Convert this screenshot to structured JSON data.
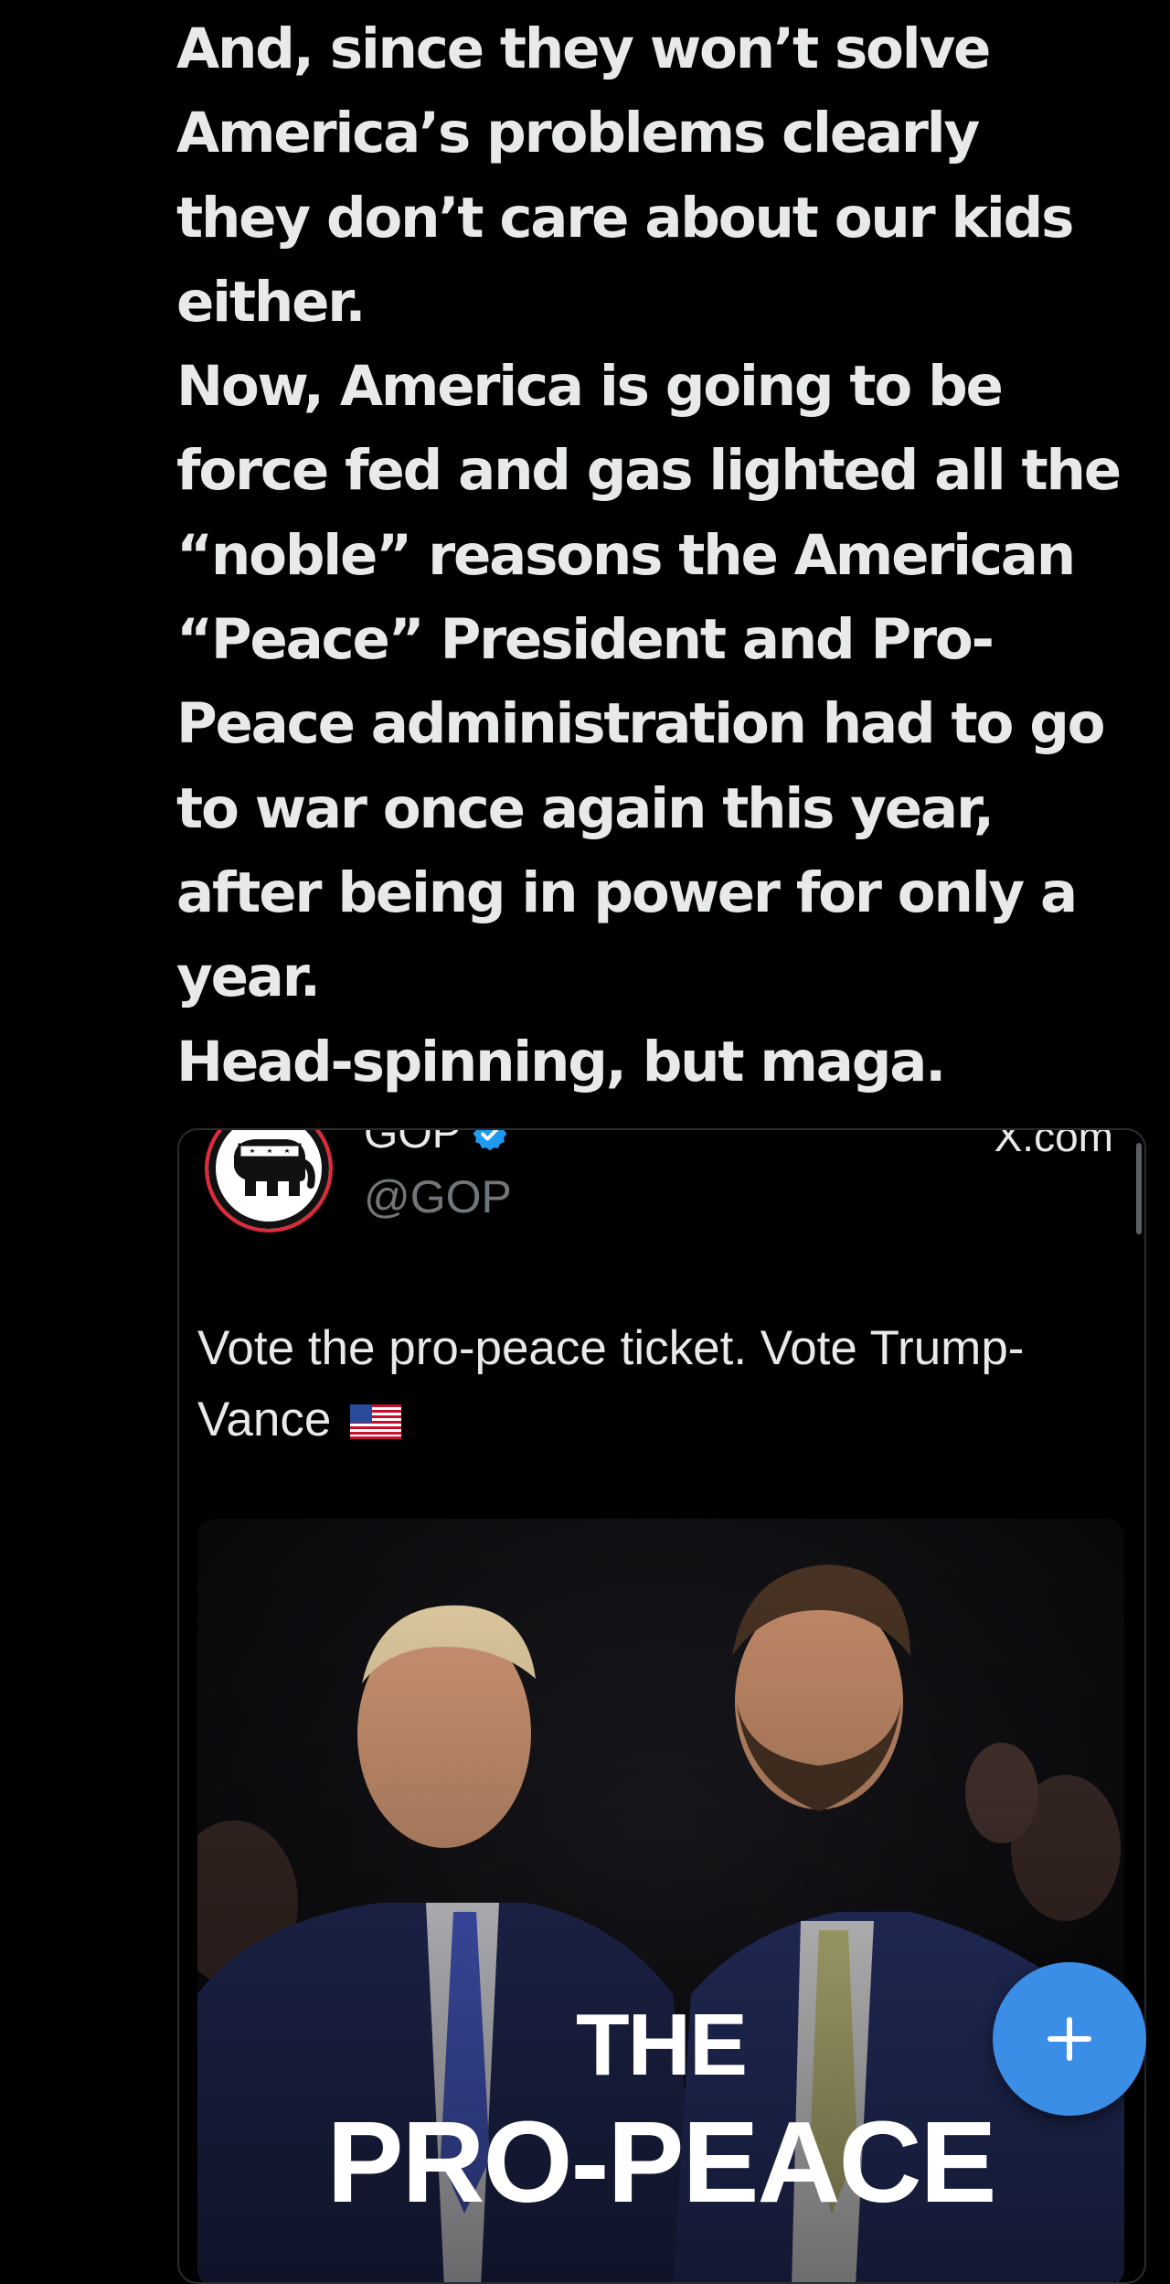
{
  "post": {
    "lines": [
      "And, since they won’t solve",
      "America’s problems clearly",
      "they don’t care about our kids",
      "either.",
      "Now, America is going to be",
      "force fed and gas lighted all the",
      "“noble” reasons the American",
      "“Peace” President and Pro-",
      "Peace administration had to go",
      "to war once again this year,",
      "after being in power for only a",
      "year.",
      "Head-spinning, but maga."
    ]
  },
  "embedded": {
    "name": "GOP",
    "handle": "@GOP",
    "source": "X.com",
    "text": "Vote the pro-peace ticket. Vote Trump-Vance",
    "verified": true,
    "flag_icon": "us-flag-icon",
    "media": {
      "caption_line1": "THE",
      "caption_line2": "PRO-PEACE"
    }
  },
  "compose": {
    "icon": "plus-icon",
    "color": "#3a8ee6"
  },
  "colors": {
    "background": "#000000",
    "text": "#e7e9ea",
    "muted": "#71767b",
    "accent": "#3a8ee6",
    "gop_red": "#e1293a"
  }
}
